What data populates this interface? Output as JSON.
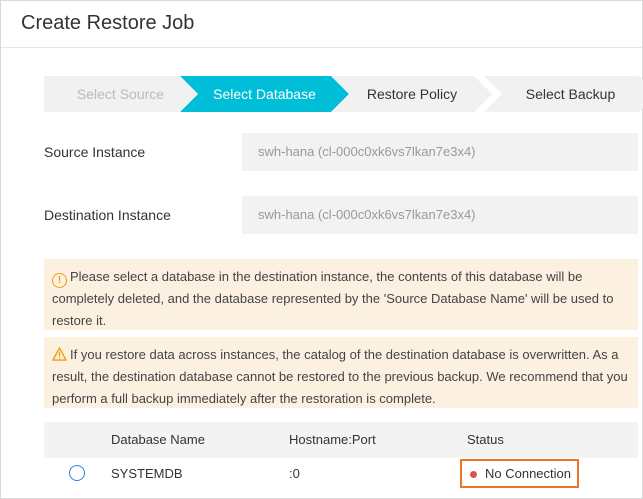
{
  "dialog": {
    "title": "Create Restore Job"
  },
  "steps": [
    {
      "label": "Select Source",
      "state": "done"
    },
    {
      "label": "Select Database",
      "state": "active"
    },
    {
      "label": "Restore Policy",
      "state": "pending"
    },
    {
      "label": "Select Backup",
      "state": "pending"
    }
  ],
  "fields": {
    "source_label": "Source Instance",
    "source_value": "swh-hana (cl-000c0xk6vs7lkan7e3x4)",
    "destination_label": "Destination Instance",
    "destination_value": "swh-hana (cl-000c0xk6vs7lkan7e3x4)"
  },
  "notices": {
    "delete_warning": "Please select a database in the destination instance, the contents of this database will be completely deleted, and the database represented by the 'Source Database Name' will be used to restore it.",
    "overwrite_warning": "If you restore data across instances, the catalog of the destination database is overwritten. As a result, the destination database cannot be restored to the previous backup. We recommend that you perform a full backup immediately after the restoration is complete."
  },
  "table": {
    "columns": [
      "Database Name",
      "Hostname:Port",
      "Status"
    ],
    "rows": [
      {
        "database": "SYSTEMDB",
        "host_port": ":0",
        "status": "No Connection",
        "selected": false
      }
    ]
  },
  "colors": {
    "accent": "#00bed7",
    "notice_bg": "#fcf0e1",
    "warning": "#f39c12",
    "highlight": "#e9762b",
    "status_error": "#d9534f"
  }
}
